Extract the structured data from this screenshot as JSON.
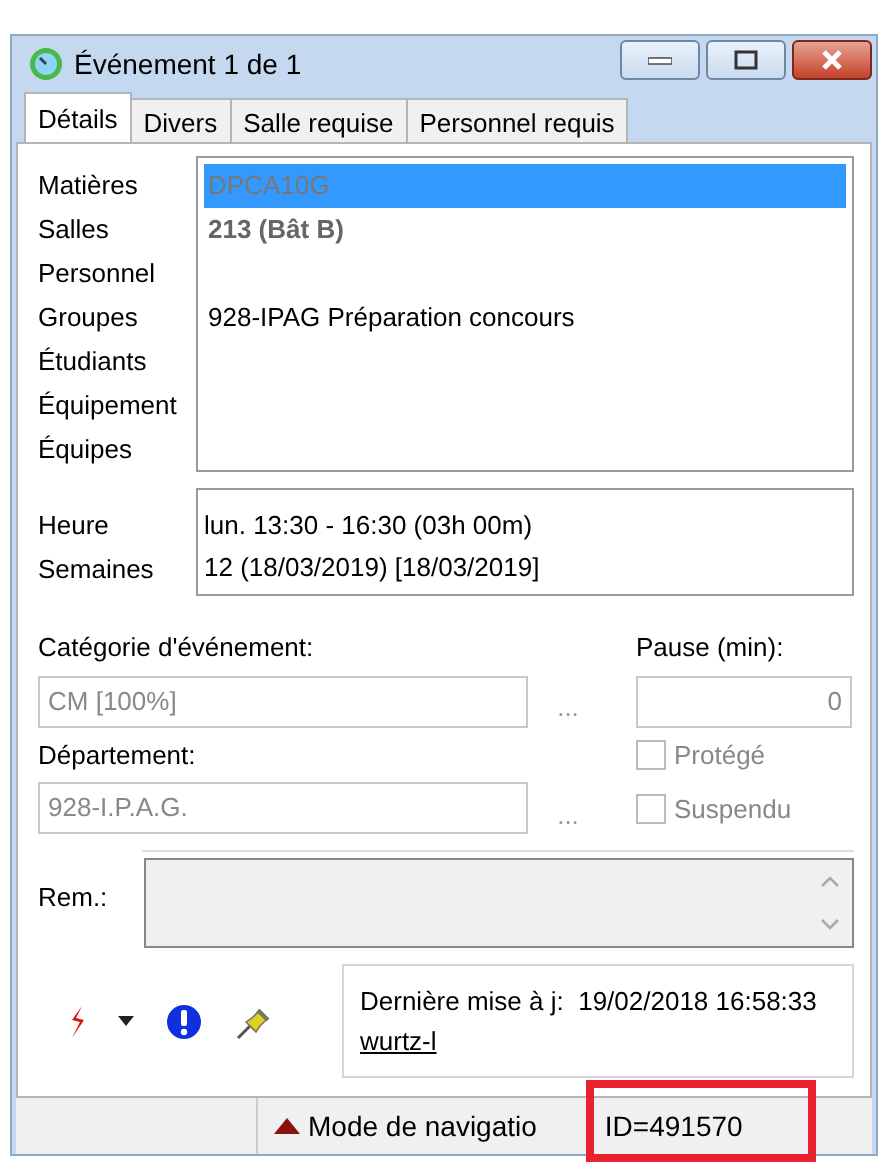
{
  "window": {
    "title": "Événement 1 de 1"
  },
  "tabs": [
    {
      "label": "Détails",
      "selected": true
    },
    {
      "label": "Divers",
      "selected": false
    },
    {
      "label": "Salle requise",
      "selected": false
    },
    {
      "label": "Personnel requis",
      "selected": false
    }
  ],
  "resources": [
    {
      "label": "Matières",
      "value": "DPCA10G",
      "selected": true,
      "bold": false
    },
    {
      "label": "Salles",
      "value": "213 (Bât B)",
      "selected": false,
      "bold": true
    },
    {
      "label": "Personnel"
    },
    {
      "label": "Groupes",
      "value": "928-IPAG Préparation concours",
      "selected": false,
      "bold": false
    },
    {
      "label": "Étudiants"
    },
    {
      "label": "Équipement"
    },
    {
      "label": "Équipes"
    }
  ],
  "timing": [
    {
      "label": "Heure",
      "value": "lun. 13:30 - 16:30 (03h 00m)"
    },
    {
      "label": "Semaines",
      "value": "12 (18/03/2019) [18/03/2019]"
    }
  ],
  "category": {
    "label": "Catégorie d'événement:",
    "value": "CM [100%]",
    "browse": "..."
  },
  "department": {
    "label": "Département:",
    "value": "928-I.P.A.G.",
    "browse": "..."
  },
  "pause": {
    "label": "Pause (min):",
    "value": "0"
  },
  "checkboxes": [
    {
      "label": "Protégé",
      "checked": false,
      "disabled": true
    },
    {
      "label": "Suspendu",
      "checked": false,
      "disabled": true
    }
  ],
  "remarks": {
    "label": "Rem.:"
  },
  "last_update": {
    "label": "Dernière mise à j:",
    "timestamp": "19/02/2018 16:58:33",
    "user": "wurtz-l"
  },
  "status_bar": {
    "mode": "Mode de navigatio",
    "id": "ID=491570",
    "highlighted": true
  }
}
